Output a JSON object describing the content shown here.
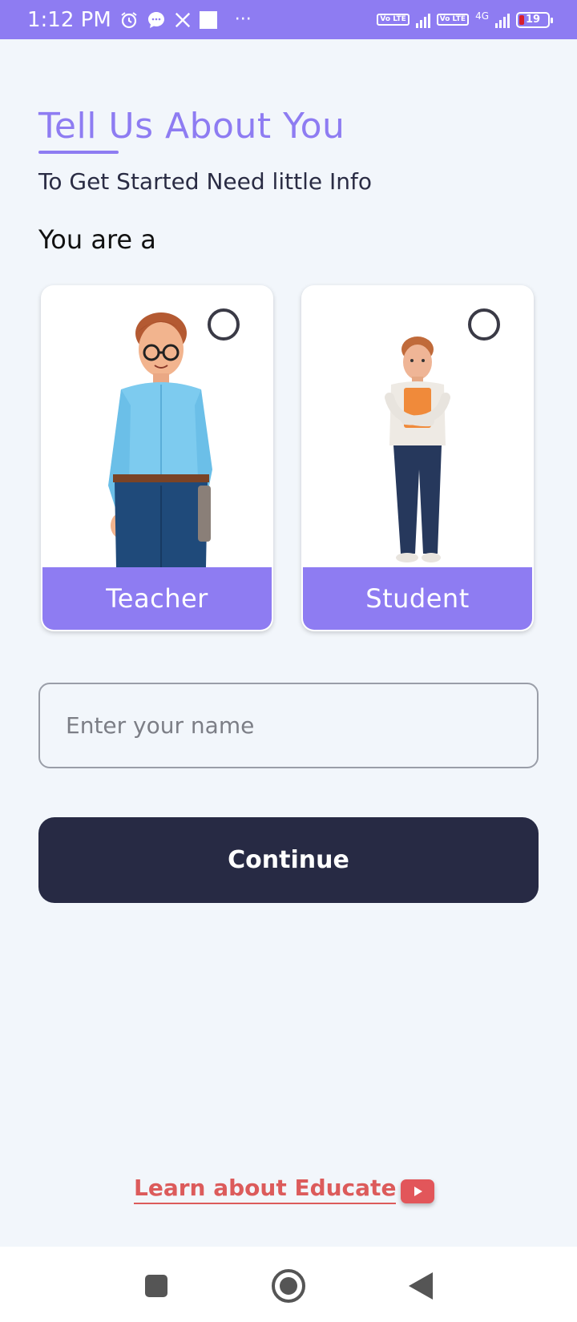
{
  "status_bar": {
    "time": "1:12 PM",
    "dots": "···",
    "network_label": "4G",
    "volte_label": "Vo LTE",
    "battery_level": "19",
    "icons": [
      "alarm-icon",
      "chat-icon",
      "x-icon",
      "square-icon",
      "volte-icon",
      "signal-icon",
      "battery-icon"
    ]
  },
  "header": {
    "title": "Tell Us About You",
    "subtitle": "To Get Started Need little Info"
  },
  "role": {
    "prompt": "You are a",
    "options": [
      {
        "label": "Teacher",
        "selected": false
      },
      {
        "label": "Student",
        "selected": false
      }
    ]
  },
  "form": {
    "name_placeholder": "Enter your name",
    "name_value": "",
    "continue_label": "Continue"
  },
  "footer": {
    "learn_link": "Learn about Educate"
  },
  "colors": {
    "accent": "#8e7cf2",
    "button_dark": "#272a44",
    "link_red": "#dc5b5b",
    "background": "#f2f6fb"
  },
  "nav": {
    "icons": [
      "recents-icon",
      "home-icon",
      "back-icon"
    ]
  }
}
